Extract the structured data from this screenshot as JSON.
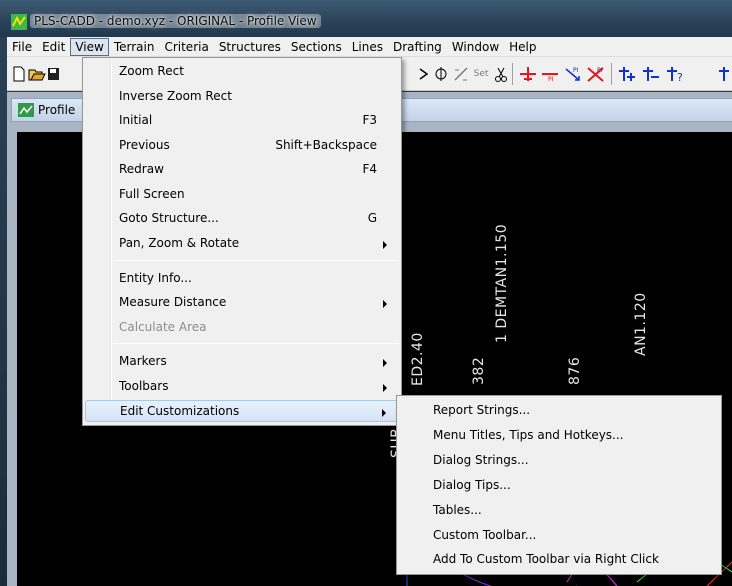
{
  "window": {
    "title": "PLS-CADD - demo.xyz - ORIGINAL - Profile View"
  },
  "menubar": [
    {
      "label": "File"
    },
    {
      "label": "Edit"
    },
    {
      "label": "View",
      "active": true
    },
    {
      "label": "Terrain"
    },
    {
      "label": "Criteria"
    },
    {
      "label": "Structures"
    },
    {
      "label": "Sections"
    },
    {
      "label": "Lines"
    },
    {
      "label": "Drafting"
    },
    {
      "label": "Window"
    },
    {
      "label": "Help"
    }
  ],
  "toolbar": {
    "set_label": "Set"
  },
  "child_window": {
    "title": "Profile"
  },
  "canvas_labels": {
    "l1": "1 DEMTAN1.150",
    "l2": "SUB",
    "l3": "ED2.40",
    "l4": "382",
    "l5": "876",
    "l6": "AN1.120"
  },
  "view_menu": [
    {
      "label": "Zoom Rect",
      "shortcut": ""
    },
    {
      "label": "Inverse Zoom Rect",
      "shortcut": ""
    },
    {
      "label": "Initial",
      "shortcut": "F3"
    },
    {
      "label": "Previous",
      "shortcut": "Shift+Backspace"
    },
    {
      "label": "Redraw",
      "shortcut": "F4"
    },
    {
      "label": "Full Screen",
      "shortcut": ""
    },
    {
      "label": "Goto Structure...",
      "shortcut": "G"
    },
    {
      "label": "Pan, Zoom & Rotate",
      "shortcut": "",
      "submenu": true
    },
    {
      "label": "Entity Info...",
      "shortcut": ""
    },
    {
      "label": "Measure Distance",
      "shortcut": "",
      "submenu": true
    },
    {
      "label": "Calculate Area",
      "shortcut": "",
      "disabled": true
    },
    {
      "label": "Markers",
      "shortcut": "",
      "submenu": true
    },
    {
      "label": "Toolbars",
      "shortcut": "",
      "submenu": true
    },
    {
      "label": "Edit Customizations",
      "shortcut": "",
      "submenu": true,
      "highlighted": true
    }
  ],
  "customizations_submenu": [
    {
      "label": "Report Strings..."
    },
    {
      "label": "Menu Titles, Tips and Hotkeys..."
    },
    {
      "label": "Dialog Strings..."
    },
    {
      "label": "Dialog Tips..."
    },
    {
      "label": "Tables..."
    },
    {
      "label": "Custom Toolbar..."
    },
    {
      "label": "Add To Custom Toolbar via Right Click"
    }
  ],
  "colors": {
    "canvas": "#000000",
    "highlight": "#d4e4f6",
    "accent_red": "#e8141e",
    "accent_blue": "#1030d0"
  }
}
